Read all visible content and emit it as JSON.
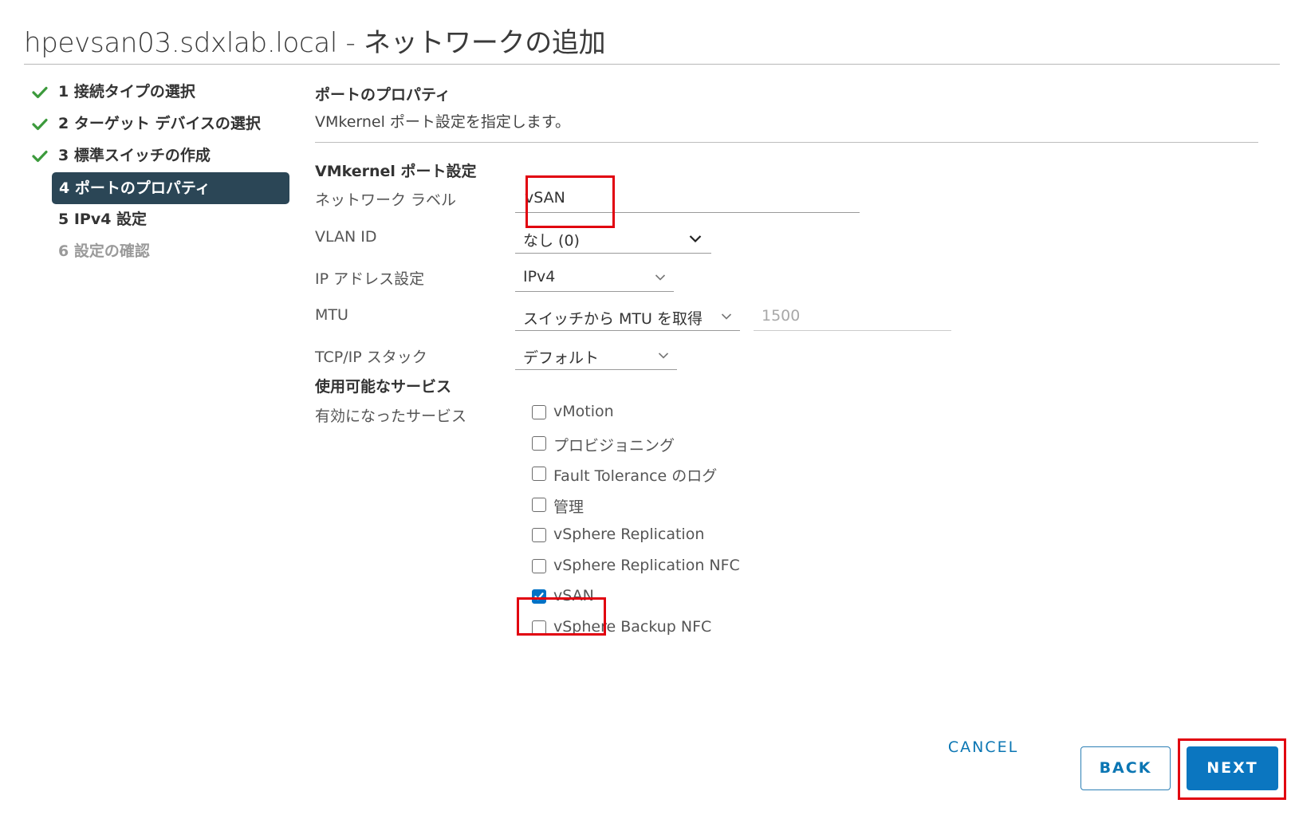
{
  "window": {
    "title": "hpevsan03.sdxlab.local - ネットワークの追加"
  },
  "steps": [
    {
      "label": "1 接続タイプの選択",
      "state": "completed"
    },
    {
      "label": "2 ターゲット デバイスの選択",
      "state": "completed"
    },
    {
      "label": "3 標準スイッチの作成",
      "state": "completed"
    },
    {
      "label": "4 ポートのプロパティ",
      "state": "active"
    },
    {
      "label": "5 IPv4 設定",
      "state": "pending"
    },
    {
      "label": "6 設定の確認",
      "state": "disabled"
    }
  ],
  "section": {
    "title": "ポートのプロパティ",
    "description": "VMkernel ポート設定を指定します。",
    "subtitle": "VMkernel ポート設定"
  },
  "form": {
    "network_label": {
      "label": "ネットワーク ラベル",
      "value": "vSAN"
    },
    "vlan_id": {
      "label": "VLAN ID",
      "value": "なし (0)"
    },
    "ip_settings": {
      "label": "IP アドレス設定",
      "value": "IPv4"
    },
    "mtu": {
      "label": "MTU",
      "value": "スイッチから MTU を取得",
      "number": "1500"
    },
    "tcpip_stack": {
      "label": "TCP/IP スタック",
      "value": "デフォルト"
    }
  },
  "services": {
    "title": "使用可能なサービス",
    "label": "有効になったサービス",
    "items": [
      {
        "label": "vMotion",
        "checked": false
      },
      {
        "label": "プロビジョニング",
        "checked": false
      },
      {
        "label": "Fault Tolerance のログ",
        "checked": false
      },
      {
        "label": "管理",
        "checked": false
      },
      {
        "label": "vSphere Replication",
        "checked": false
      },
      {
        "label": "vSphere Replication NFC",
        "checked": false
      },
      {
        "label": "vSAN",
        "checked": true
      },
      {
        "label": "vSphere Backup NFC",
        "checked": false
      }
    ]
  },
  "buttons": {
    "cancel": "CANCEL",
    "back": "BACK",
    "next": "NEXT"
  },
  "colors": {
    "active_step_bg": "#2b4656",
    "check_green": "#3c9a3c",
    "primary_blue": "#0b76c0",
    "highlight_red": "#e1000f"
  }
}
